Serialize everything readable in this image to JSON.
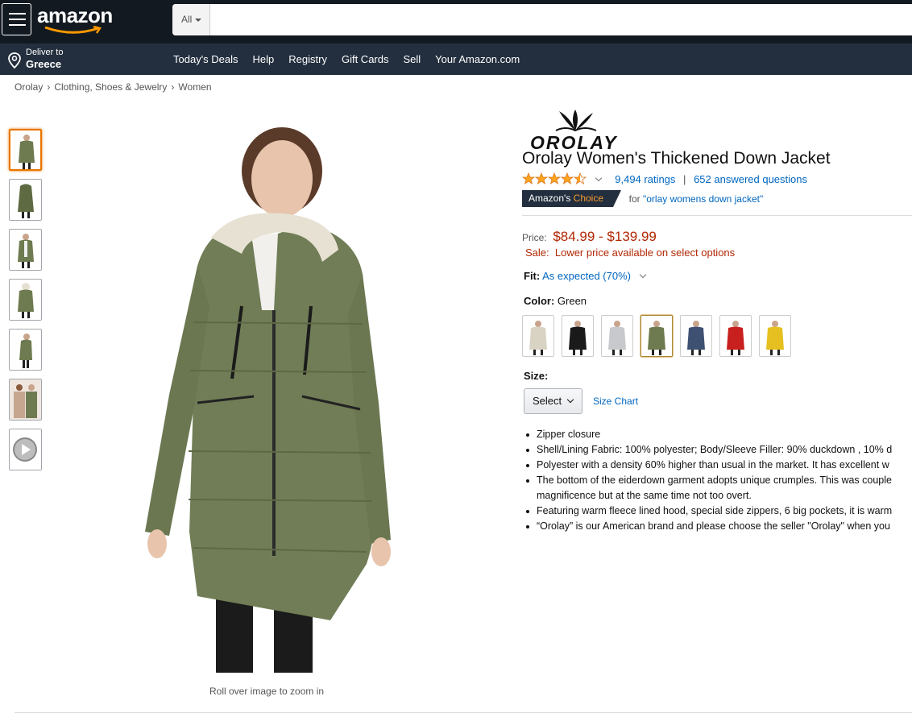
{
  "header": {
    "logo_text": "amazon",
    "search_category": "All",
    "search_value": "",
    "deliver_label": "Deliver to",
    "deliver_location": "Greece"
  },
  "nav": {
    "links": [
      "Today's Deals",
      "Help",
      "Registry",
      "Gift Cards",
      "Sell",
      "Your Amazon.com"
    ]
  },
  "breadcrumb": [
    "Orolay",
    "Clothing, Shoes & Jewelry",
    "Women"
  ],
  "gallery": {
    "zoom_note": "Roll over image to zoom in",
    "thumb_count": 7
  },
  "product": {
    "brand_logo_text": "OROLAY",
    "title": "Orolay Women's Thickened Down Jacket",
    "rating": 4.5,
    "ratings_count": "9,494 ratings",
    "answered_questions": "652 answered questions",
    "choice_badge_a": "Amazon's",
    "choice_badge_b": "Choice",
    "choice_for": "for ",
    "choice_query": "\"orlay womens down jacket\"",
    "price_label": "Price:",
    "price": "$84.99 - $139.99",
    "sale_text": "Sale:  Lower price available on select options",
    "fit_label": "Fit:",
    "fit_value": "As expected (70%)",
    "color_label": "Color:",
    "color_value": "Green",
    "size_label": "Size:",
    "size_select": "Select",
    "size_chart": "Size Chart",
    "bullets": [
      "Zipper closure",
      "Shell/Lining Fabric: 100% polyester; Body/Sleeve Filler: 90% duckdown , 10% d",
      "Polyester with a density 60% higher than usual in the market. It has excellent w",
      "The bottom of the eiderdown garment adopts unique crumples. This was couple magnificence but at the same time not too overt.",
      "Featuring warm fleece lined hood, special side zippers, 6 big pockets, it is warm",
      "“Orolay” is our American brand and please choose the seller \"Orolay\" when you"
    ]
  },
  "colors": {
    "swatches": [
      "#d9d3c3",
      "#1a1a1a",
      "#c7c9cc",
      "#6e7a4f",
      "#3f5173",
      "#c8201f",
      "#e5c020"
    ],
    "selected_index": 3,
    "accent_orange": "#e77600",
    "price_red": "#b12704",
    "link_blue": "#0066c0"
  }
}
